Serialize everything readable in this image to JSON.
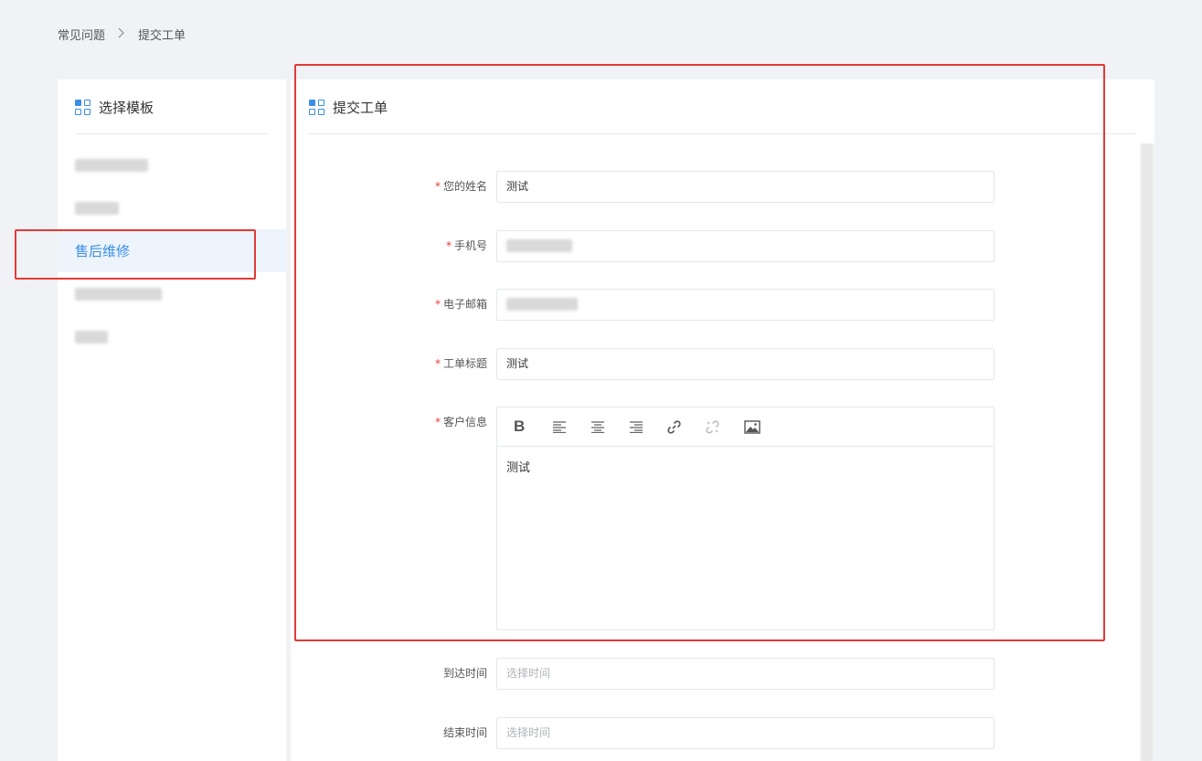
{
  "breadcrumb": {
    "items": [
      "常见问题",
      "提交工单"
    ],
    "separator": ">"
  },
  "left_panel": {
    "title": "选择模板",
    "items": [
      {
        "label": "",
        "blurred": true,
        "active": false
      },
      {
        "label": "",
        "blurred": true,
        "active": false
      },
      {
        "label": "售后维修",
        "blurred": false,
        "active": true
      },
      {
        "label": "",
        "blurred": true,
        "active": false
      },
      {
        "label": "",
        "blurred": true,
        "active": false
      }
    ]
  },
  "form": {
    "title": "提交工单",
    "fields": [
      {
        "label": "您的姓名",
        "required": true,
        "value": "测试",
        "placeholder": ""
      },
      {
        "label": "手机号",
        "required": true,
        "value": "",
        "placeholder": "",
        "blurred": true
      },
      {
        "label": "电子邮箱",
        "required": true,
        "value": "",
        "placeholder": "",
        "blurred": true
      },
      {
        "label": "工单标题",
        "required": true,
        "value": "测试",
        "placeholder": ""
      },
      {
        "label": "客户信息",
        "required": true,
        "value": "测试",
        "type": "rich-text"
      },
      {
        "label": "到达时间",
        "required": false,
        "value": "",
        "placeholder": "选择时间"
      },
      {
        "label": "结束时间",
        "required": false,
        "value": "",
        "placeholder": "选择时间"
      }
    ],
    "editor_toolbar": [
      "bold-icon",
      "align-left-icon",
      "align-center-icon",
      "align-right-icon",
      "link-icon",
      "unlink-icon",
      "image-icon"
    ]
  },
  "colors": {
    "accent": "#3a8ee6",
    "required": "#e53935",
    "highlight": "#e53935",
    "background": "#f0f2f5"
  }
}
